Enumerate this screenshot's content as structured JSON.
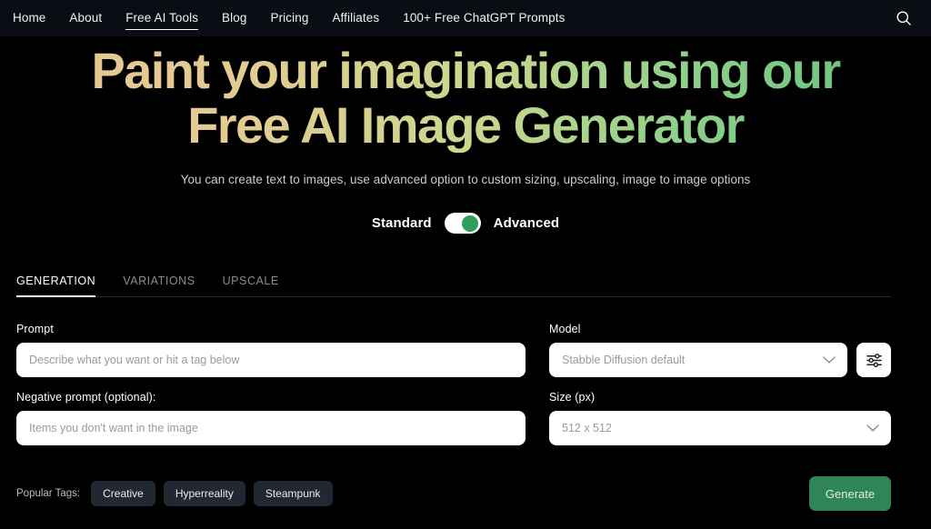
{
  "nav": {
    "items": [
      {
        "label": "Home",
        "active": false
      },
      {
        "label": "About",
        "active": false
      },
      {
        "label": "Free AI Tools",
        "active": true
      },
      {
        "label": "Blog",
        "active": false
      },
      {
        "label": "Pricing",
        "active": false
      },
      {
        "label": "Affiliates",
        "active": false
      },
      {
        "label": "100+ Free ChatGPT Prompts",
        "active": false
      }
    ],
    "search_icon": "search-icon"
  },
  "hero": {
    "title_line1": "Paint your imagination using our",
    "title_line2": "Free AI Image Generator",
    "subtitle": "You can create text to images, use advanced option to custom sizing, upscaling, image to image options",
    "gradient_start": "#e8c595",
    "gradient_end": "#5ebf7c"
  },
  "mode": {
    "left_label": "Standard",
    "right_label": "Advanced",
    "active": "Advanced",
    "knob_color": "#2f9e5f",
    "track_color": "#ffffff"
  },
  "tabs": [
    {
      "label": "GENERATION",
      "active": true
    },
    {
      "label": "VARIATIONS",
      "active": false
    },
    {
      "label": "UPSCALE",
      "active": false
    }
  ],
  "form": {
    "prompt": {
      "label": "Prompt",
      "value": "",
      "placeholder": "Describe what you want or hit a tag below"
    },
    "negative_prompt": {
      "label": "Negative prompt (optional):",
      "value": "",
      "placeholder": "Items you don't want in the image"
    },
    "model": {
      "label": "Model",
      "value": "Stabble Diffusion default",
      "chevron_icon": "chevron-down-icon",
      "settings_icon": "sliders-icon"
    },
    "size": {
      "label": "Size (px)",
      "value": "512 x 512",
      "chevron_icon": "chevron-down-icon"
    }
  },
  "bottom": {
    "tags_label": "Popular Tags:",
    "tags": [
      "Creative",
      "Hyperreality",
      "Steampunk"
    ],
    "generate_label": "Generate",
    "generate_color": "#2f8555"
  }
}
